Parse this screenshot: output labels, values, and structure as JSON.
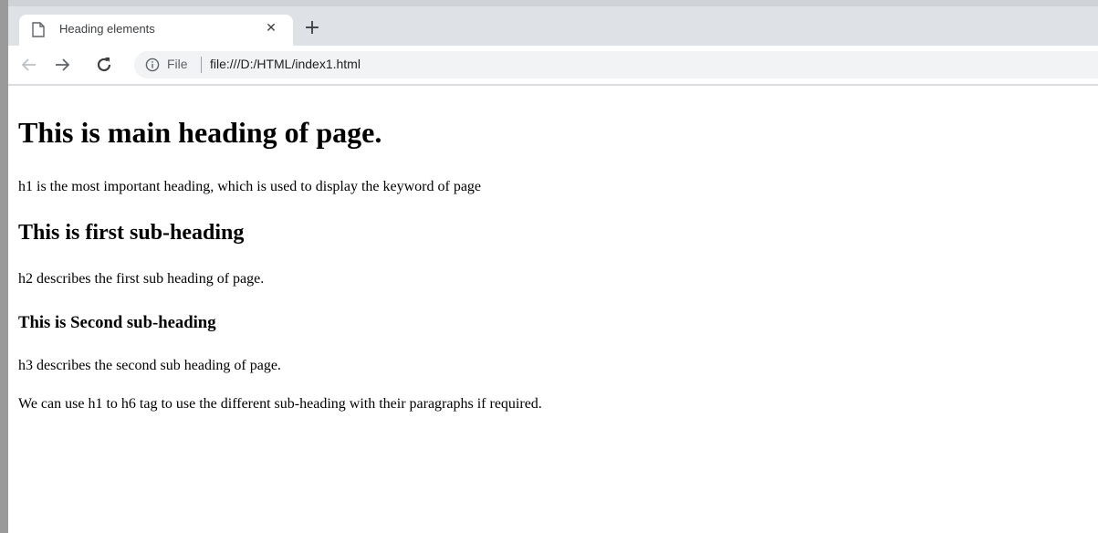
{
  "browser": {
    "tab": {
      "title": "Heading elements",
      "close_glyph": "✕",
      "icon": "page-icon"
    },
    "new_tab_glyph": "+",
    "toolbar": {
      "back_icon": "back-arrow-icon",
      "forward_icon": "forward-arrow-icon",
      "reload_icon": "reload-icon",
      "site_info_icon": "info-icon",
      "scheme_label": "File",
      "url": "file:///D:/HTML/index1.html"
    }
  },
  "page": {
    "h1": "This is main heading of page.",
    "p1": "h1 is the most important heading, which is used to display the keyword of page",
    "h2": "This is first sub-heading",
    "p2": "h2 describes the first sub heading of page.",
    "h3": "This is Second sub-heading",
    "p3": "h3 describes the second sub heading of page.",
    "p4": "We can use h1 to h6 tag to use the different sub-heading with their paragraphs if required."
  }
}
